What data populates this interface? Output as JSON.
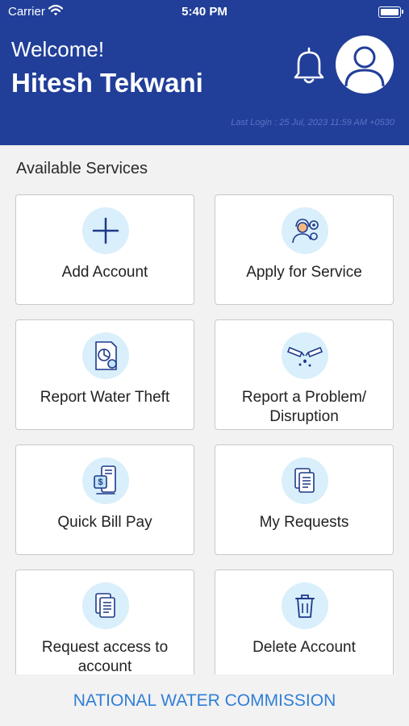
{
  "status_bar": {
    "carrier": "Carrier",
    "time": "5:40 PM"
  },
  "header": {
    "welcome": "Welcome!",
    "username": "Hitesh Tekwani",
    "last_login": "Last Login : 25 Jul, 2023 11:59 AM +0530"
  },
  "section_title": "Available Services",
  "services": [
    {
      "label": "Add Account",
      "icon": "plus-icon"
    },
    {
      "label": "Apply for Service",
      "icon": "technician-icon"
    },
    {
      "label": "Report Water Theft",
      "icon": "report-document-icon"
    },
    {
      "label": "Report a Problem/ Disruption",
      "icon": "broken-pipe-icon"
    },
    {
      "label": "Quick Bill Pay",
      "icon": "mobile-payment-icon"
    },
    {
      "label": "My Requests",
      "icon": "documents-icon"
    },
    {
      "label": "Request access to account",
      "icon": "documents-icon"
    },
    {
      "label": "Delete Account",
      "icon": "trash-icon"
    }
  ],
  "footer": {
    "organization": "NATIONAL WATER COMMISSION"
  },
  "colors": {
    "header_bg": "#213f99",
    "icon_bg": "#d9effb",
    "icon_stroke": "#1f3a8a",
    "footer_text": "#2f7fd6"
  }
}
